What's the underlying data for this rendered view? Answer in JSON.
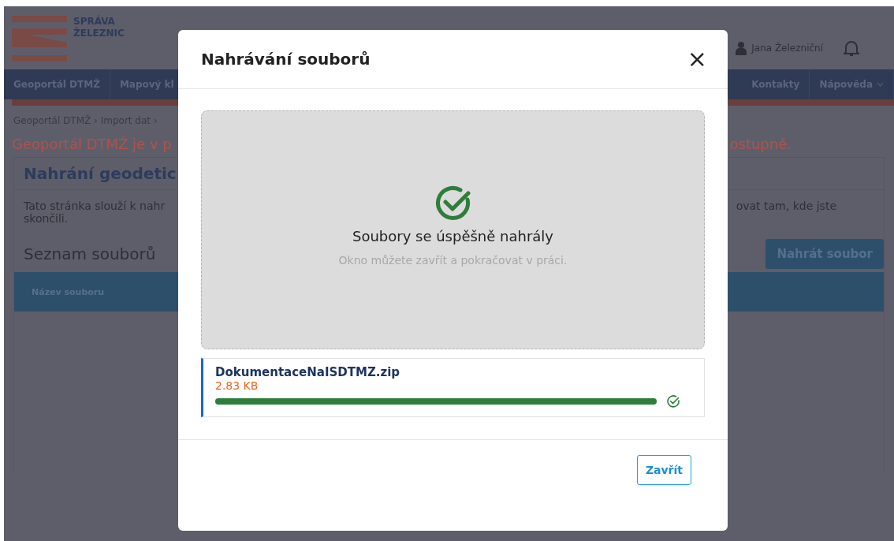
{
  "background": {
    "logo": {
      "lines": [
        "SPRÁVA",
        "ŽELEZNIC"
      ]
    },
    "user": "Jana Železniční",
    "nav_left": [
      "Geoportál DTMŽ",
      "Mapový kl"
    ],
    "nav_right": [
      {
        "label": "Kontakty",
        "has_menu": false
      },
      {
        "label": "Nápověda",
        "has_menu": true
      }
    ],
    "breadcrumb": "Geoportál DTMŽ › Import dat ›",
    "notice_left": "Geoportál DTMŽ je v p",
    "notice_right": "ostupně.",
    "section_title": "Nahrání geodetic",
    "description_left": "Tato stránka slouží k nahr",
    "description_left_2": "skončili.",
    "description_right": "ovat tam, kde jste",
    "list_title": "Seznam souborů",
    "upload_button": "Nahrát soubor",
    "table": {
      "columns": [
        "Název souboru"
      ]
    }
  },
  "dialog": {
    "title": "Nahrávání souborů",
    "close": "×",
    "status": {
      "kind": "success",
      "title": "Soubory se úspěšně nahrály",
      "hint": "Okno můžete zavřít a pokračovat v práci."
    },
    "files": [
      {
        "name": "DokumentaceNaISDTMZ.zip",
        "size": "2.83 KB",
        "level": 1,
        "done": true
      }
    ],
    "buttons": [
      "Zavřít"
    ]
  }
}
